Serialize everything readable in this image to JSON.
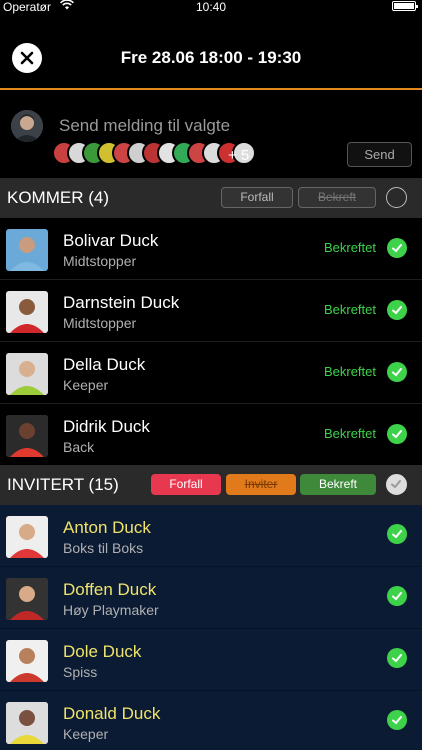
{
  "status_bar": {
    "carrier": "Operatør",
    "time": "10:40"
  },
  "header": {
    "title": "Fre 28.06 18:00 - 19:30"
  },
  "compose": {
    "placeholder": "Send melding til valgte",
    "more_count": "+ 5",
    "send_label": "Send",
    "avatar_colors": [
      "#c94040",
      "#c9402f",
      "#3a9a3a",
      "#d0c030",
      "#5c5ccf",
      "#b33",
      "#d88",
      "#3a5",
      "#c44",
      "#8a8",
      "#cc3030",
      "#444"
    ]
  },
  "sections": {
    "kommer": {
      "label": "KOMMER (4)",
      "btn_forfall": "Forfall",
      "btn_bekreft": "Bekreft"
    },
    "invitert": {
      "label": "INVITERT (15)",
      "btn_forfall": "Forfall",
      "btn_inviter": "Inviter",
      "btn_bekreft": "Bekreft"
    }
  },
  "kommer_players": [
    {
      "name": "Bolivar Duck",
      "role": "Midtstopper",
      "status": "Bekreftet",
      "avatar_color": "#6aa9d8"
    },
    {
      "name": "Darnstein Duck",
      "role": "Midtstopper",
      "status": "Bekreftet",
      "avatar_color": "#c8302c"
    },
    {
      "name": "Della Duck",
      "role": "Keeper",
      "status": "Bekreftet",
      "avatar_color": "#8fc23a"
    },
    {
      "name": "Didrik Duck",
      "role": "Back",
      "status": "Bekreftet",
      "avatar_color": "#d8342a"
    }
  ],
  "invitert_players": [
    {
      "name": "Anton Duck",
      "role": "Boks til Boks",
      "avatar_color": "#e03838"
    },
    {
      "name": "Doffen Duck",
      "role": "Høy Playmaker",
      "avatar_color": "#c02828"
    },
    {
      "name": "Dole Duck",
      "role": "Spiss",
      "avatar_color": "#cc3a2e"
    },
    {
      "name": "Donald Duck",
      "role": "Keeper",
      "avatar_color": "#e4d43a"
    }
  ],
  "colors": {
    "accent_orange": "#e08a1e",
    "confirmed_green": "#3ed24b",
    "forfall_red": "#e8384f",
    "inviter_orange": "#e07a1a",
    "bekreft_green": "#3e8a3a",
    "invited_name_yellow": "#f0e36a"
  }
}
